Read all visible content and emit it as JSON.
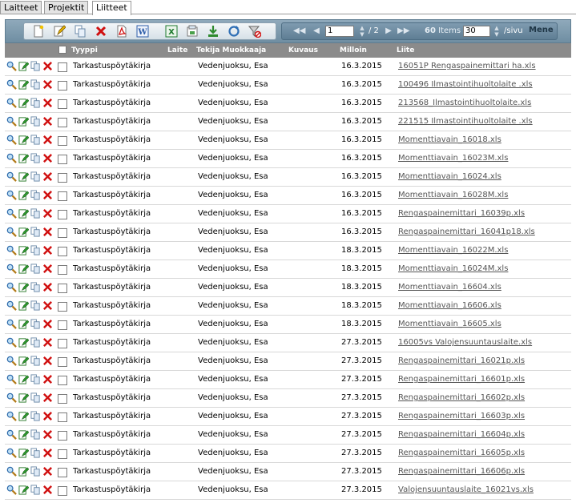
{
  "tabs": [
    {
      "label": "Laitteet",
      "active": false
    },
    {
      "label": "Projektit",
      "active": false
    },
    {
      "label": "Liitteet",
      "active": true
    }
  ],
  "toolbar": {
    "buttons": [
      "new-icon",
      "edit-icon",
      "copy-icon",
      "delete-icon",
      "pdf-icon",
      "word-icon",
      "excel-icon",
      "import-icon",
      "download-icon",
      "refresh-icon",
      "clear-filter-icon"
    ]
  },
  "pager": {
    "page": "1",
    "total_pages": "/ 2",
    "items_count": "60",
    "items_label": "Items",
    "per_page": "30",
    "per_page_label": "/sivu",
    "go_label": "Mene"
  },
  "columns": {
    "type": "Tyyppi",
    "device": "Laite",
    "author": "Tekija Muokkaaja",
    "description": "Kuvaus",
    "date": "Milloin",
    "attachment": "Liite"
  },
  "rows": [
    {
      "type": "Tarkastuspöytäkirja",
      "author": "Vedenjuoksu, Esa",
      "date": "16.3.2015",
      "attachment": "16051P Rengaspainemittari ha.xls"
    },
    {
      "type": "Tarkastuspöytäkirja",
      "author": "Vedenjuoksu, Esa",
      "date": "16.3.2015",
      "attachment": "100496 Ilmastointihuoltolaite .xls"
    },
    {
      "type": "Tarkastuspöytäkirja",
      "author": "Vedenjuoksu, Esa",
      "date": "16.3.2015",
      "attachment": "213568_Ilmastointihuoltolaite.xls"
    },
    {
      "type": "Tarkastuspöytäkirja",
      "author": "Vedenjuoksu, Esa",
      "date": "16.3.2015",
      "attachment": "221515 Ilmastointihuoltolaite .xls"
    },
    {
      "type": "Tarkastuspöytäkirja",
      "author": "Vedenjuoksu, Esa",
      "date": "16.3.2015",
      "attachment": "Momenttiavain_16018.xls"
    },
    {
      "type": "Tarkastuspöytäkirja",
      "author": "Vedenjuoksu, Esa",
      "date": "16.3.2015",
      "attachment": "Momenttiavain_16023M.xls"
    },
    {
      "type": "Tarkastuspöytäkirja",
      "author": "Vedenjuoksu, Esa",
      "date": "16.3.2015",
      "attachment": "Momenttiavain_16024.xls"
    },
    {
      "type": "Tarkastuspöytäkirja",
      "author": "Vedenjuoksu, Esa",
      "date": "16.3.2015",
      "attachment": "Momenttiavain_16028M.xls"
    },
    {
      "type": "Tarkastuspöytäkirja",
      "author": "Vedenjuoksu, Esa",
      "date": "16.3.2015",
      "attachment": "Rengaspainemittari_16039p.xls"
    },
    {
      "type": "Tarkastuspöytäkirja",
      "author": "Vedenjuoksu, Esa",
      "date": "16.3.2015",
      "attachment": "Rengaspainemittari_16041p18.xls"
    },
    {
      "type": "Tarkastuspöytäkirja",
      "author": "Vedenjuoksu, Esa",
      "date": "18.3.2015",
      "attachment": "Momenttiavain_16022M.xls"
    },
    {
      "type": "Tarkastuspöytäkirja",
      "author": "Vedenjuoksu, Esa",
      "date": "18.3.2015",
      "attachment": "Momenttiavain_16024M.xls"
    },
    {
      "type": "Tarkastuspöytäkirja",
      "author": "Vedenjuoksu, Esa",
      "date": "18.3.2015",
      "attachment": "Momenttiavain_16604.xls"
    },
    {
      "type": "Tarkastuspöytäkirja",
      "author": "Vedenjuoksu, Esa",
      "date": "18.3.2015",
      "attachment": "Momenttiavain_16606.xls"
    },
    {
      "type": "Tarkastuspöytäkirja",
      "author": "Vedenjuoksu, Esa",
      "date": "18.3.2015",
      "attachment": "Momenttiavain_16605.xls"
    },
    {
      "type": "Tarkastuspöytäkirja",
      "author": "Vedenjuoksu, Esa",
      "date": "27.3.2015",
      "attachment": "16005vs Valojensuuntauslaite.xls"
    },
    {
      "type": "Tarkastuspöytäkirja",
      "author": "Vedenjuoksu, Esa",
      "date": "27.3.2015",
      "attachment": "Rengaspainemittari_16021p.xls"
    },
    {
      "type": "Tarkastuspöytäkirja",
      "author": "Vedenjuoksu, Esa",
      "date": "27.3.2015",
      "attachment": "Rengaspainemittari_16601p.xls"
    },
    {
      "type": "Tarkastuspöytäkirja",
      "author": "Vedenjuoksu, Esa",
      "date": "27.3.2015",
      "attachment": "Rengaspainemittari_16602p.xls"
    },
    {
      "type": "Tarkastuspöytäkirja",
      "author": "Vedenjuoksu, Esa",
      "date": "27.3.2015",
      "attachment": "Rengaspainemittari_16603p.xls"
    },
    {
      "type": "Tarkastuspöytäkirja",
      "author": "Vedenjuoksu, Esa",
      "date": "27.3.2015",
      "attachment": "Rengaspainemittari_16604p.xls"
    },
    {
      "type": "Tarkastuspöytäkirja",
      "author": "Vedenjuoksu, Esa",
      "date": "27.3.2015",
      "attachment": "Rengaspainemittari_16605p.xls"
    },
    {
      "type": "Tarkastuspöytäkirja",
      "author": "Vedenjuoksu, Esa",
      "date": "27.3.2015",
      "attachment": "Rengaspainemittari_16606p.xls"
    },
    {
      "type": "Tarkastuspöytäkirja",
      "author": "Vedenjuoksu, Esa",
      "date": "27.3.2015",
      "attachment": "Valojensuuntauslaite_16021vs.xls"
    }
  ]
}
